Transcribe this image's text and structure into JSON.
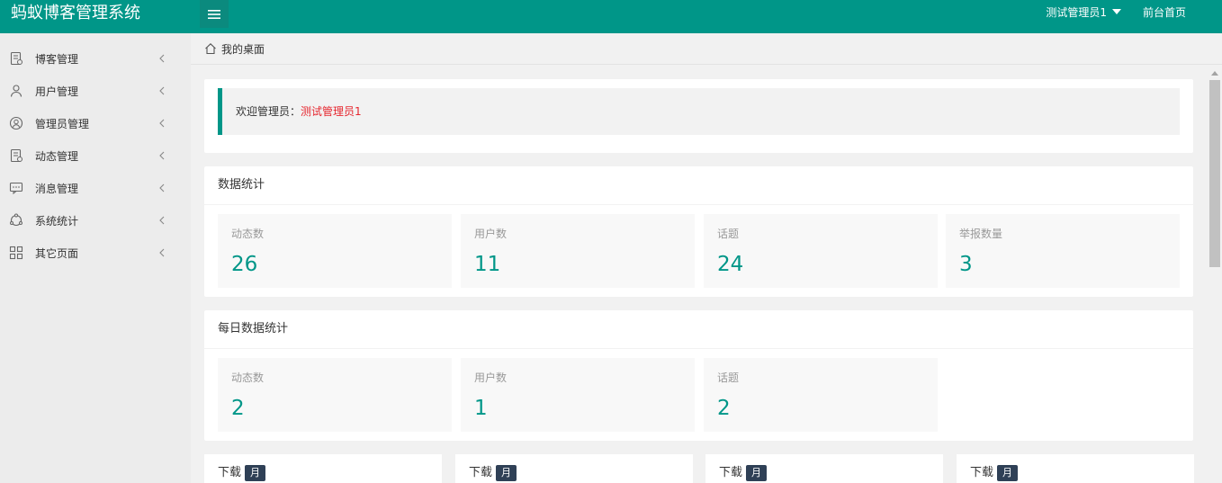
{
  "header": {
    "brand": "蚂蚁博客管理系统",
    "user": "测试管理员1",
    "front_link": "前台首页",
    "accent": "#009688"
  },
  "sidebar": {
    "items": [
      {
        "label": "博客管理",
        "icon": "document-icon"
      },
      {
        "label": "用户管理",
        "icon": "user-icon"
      },
      {
        "label": "管理员管理",
        "icon": "user-circle-icon"
      },
      {
        "label": "动态管理",
        "icon": "document-icon"
      },
      {
        "label": "消息管理",
        "icon": "message-icon"
      },
      {
        "label": "系统统计",
        "icon": "chart-icon"
      },
      {
        "label": "其它页面",
        "icon": "grid-icon"
      }
    ]
  },
  "breadcrumb": {
    "label": "我的桌面"
  },
  "welcome": {
    "prefix": "欢迎管理员：",
    "name": "测试管理员1"
  },
  "stats": {
    "title": "数据统计",
    "items": [
      {
        "label": "动态数",
        "value": "26"
      },
      {
        "label": "用户数",
        "value": "11"
      },
      {
        "label": "话题",
        "value": "24"
      },
      {
        "label": "举报数量",
        "value": "3"
      }
    ]
  },
  "daily": {
    "title": "每日数据统计",
    "items": [
      {
        "label": "动态数",
        "value": "2"
      },
      {
        "label": "用户数",
        "value": "1"
      },
      {
        "label": "话题",
        "value": "2"
      }
    ]
  },
  "downloads": [
    {
      "label": "下载",
      "badge": "月"
    },
    {
      "label": "下载",
      "badge": "月"
    },
    {
      "label": "下载",
      "badge": "月"
    },
    {
      "label": "下载",
      "badge": "月"
    }
  ]
}
